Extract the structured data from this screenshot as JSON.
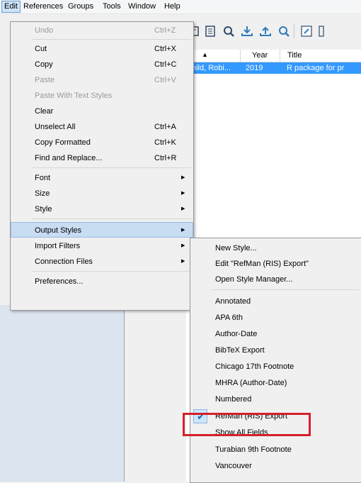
{
  "menubar": {
    "items": [
      "Edit",
      "References",
      "Groups",
      "Tools",
      "Window",
      "Help"
    ]
  },
  "list": {
    "columns": [
      "Year",
      "Title"
    ],
    "selected_row": {
      "author": "hild, Robi...",
      "year": "2019",
      "title": "R package for pr"
    }
  },
  "edit_menu": {
    "items": [
      {
        "label": "Undo",
        "shortcut": "Ctrl+Z",
        "disabled": true
      },
      {
        "label": "Cut",
        "shortcut": "Ctrl+X"
      },
      {
        "label": "Copy",
        "shortcut": "Ctrl+C"
      },
      {
        "label": "Paste",
        "shortcut": "Ctrl+V",
        "disabled": true
      },
      {
        "label": "Paste With Text Styles",
        "shortcut": "",
        "disabled": true
      },
      {
        "label": "Clear",
        "shortcut": ""
      },
      {
        "label": "Unselect All",
        "shortcut": "Ctrl+A"
      },
      {
        "label": "Copy Formatted",
        "shortcut": "Ctrl+K"
      },
      {
        "label": "Find and Replace...",
        "shortcut": "Ctrl+R"
      },
      {
        "label": "Font",
        "submenu": true
      },
      {
        "label": "Size",
        "submenu": true
      },
      {
        "label": "Style",
        "submenu": true
      },
      {
        "label": "Output Styles",
        "submenu": true,
        "active": true
      },
      {
        "label": "Import Filters",
        "submenu": true
      },
      {
        "label": "Connection Files",
        "submenu": true
      },
      {
        "label": "Preferences..."
      }
    ]
  },
  "output_styles_menu": {
    "actions": [
      "New Style...",
      "Edit \"RefMan (RIS) Export\"",
      "Open Style Manager..."
    ],
    "styles": [
      "Annotated",
      "APA 6th",
      "Author-Date",
      "BibTeX Export",
      "Chicago 17th Footnote",
      "MHRA (Author-Date)",
      "Numbered",
      "RefMan (RIS) Export",
      "Show All Fields",
      "Turabian 9th Footnote",
      "Vancouver"
    ],
    "checked": "RefMan (RIS) Export"
  },
  "colors": {
    "selection": "#3399ff",
    "menu_hover": "#c8dcf2",
    "highlight_box": "#d4202a"
  }
}
